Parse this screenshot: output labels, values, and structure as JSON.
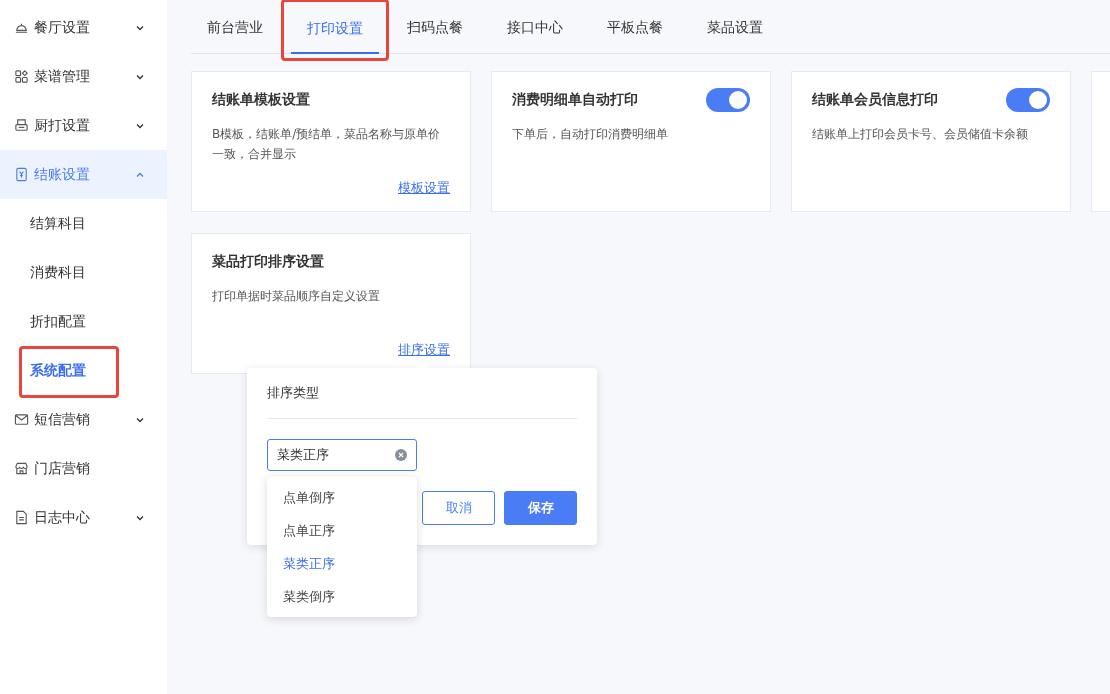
{
  "sidebar": {
    "items": [
      {
        "label": "餐厅设置",
        "expanded": false,
        "selected": false
      },
      {
        "label": "菜谱管理",
        "expanded": false,
        "selected": false
      },
      {
        "label": "厨打设置",
        "expanded": false,
        "selected": false
      },
      {
        "label": "结账设置",
        "expanded": true,
        "selected": true,
        "children": [
          {
            "label": "结算科目",
            "selected": false,
            "highlighted": false
          },
          {
            "label": "消费科目",
            "selected": false,
            "highlighted": false
          },
          {
            "label": "折扣配置",
            "selected": false,
            "highlighted": false
          },
          {
            "label": "系统配置",
            "selected": true,
            "highlighted": true
          }
        ]
      },
      {
        "label": "短信营销",
        "expanded": false,
        "selected": false
      },
      {
        "label": "门店营销",
        "selected": false
      },
      {
        "label": "日志中心",
        "expanded": false,
        "selected": false
      }
    ]
  },
  "tabs": [
    {
      "label": "前台营业",
      "selected": false,
      "highlighted": false
    },
    {
      "label": "打印设置",
      "selected": true,
      "highlighted": true
    },
    {
      "label": "扫码点餐",
      "selected": false,
      "highlighted": false
    },
    {
      "label": "接口中心",
      "selected": false,
      "highlighted": false
    },
    {
      "label": "平板点餐",
      "selected": false,
      "highlighted": false
    },
    {
      "label": "菜品设置",
      "selected": false,
      "highlighted": false
    }
  ],
  "cards": [
    {
      "kind": "link",
      "title": "结账单模板设置",
      "description": "B模板，结账单/预结单，菜品名称与原单价一致，合并显示",
      "link": "模板设置"
    },
    {
      "kind": "toggle",
      "title": "消费明细单自动打印",
      "description": "下单后，自动打印消费明细单",
      "on": true
    },
    {
      "kind": "toggle",
      "title": "结账单会员信息打印",
      "description": "结账单上打印会员卡号、会员储值卡余额",
      "on": true
    },
    {
      "kind": "cut"
    },
    {
      "kind": "link",
      "title": "菜品打印排序设置",
      "description": "打印单据时菜品顺序自定义设置",
      "link": "排序设置"
    }
  ],
  "popover": {
    "title": "排序类型",
    "select": {
      "value": "菜类正序",
      "options": [
        {
          "label": "点单倒序",
          "selected": false
        },
        {
          "label": "点单正序",
          "selected": false
        },
        {
          "label": "菜类正序",
          "selected": true
        },
        {
          "label": "菜类倒序",
          "selected": false
        }
      ]
    },
    "buttons": [
      {
        "label": "取消",
        "kind": "secondary"
      },
      {
        "label": "保存",
        "kind": "primary"
      }
    ]
  }
}
